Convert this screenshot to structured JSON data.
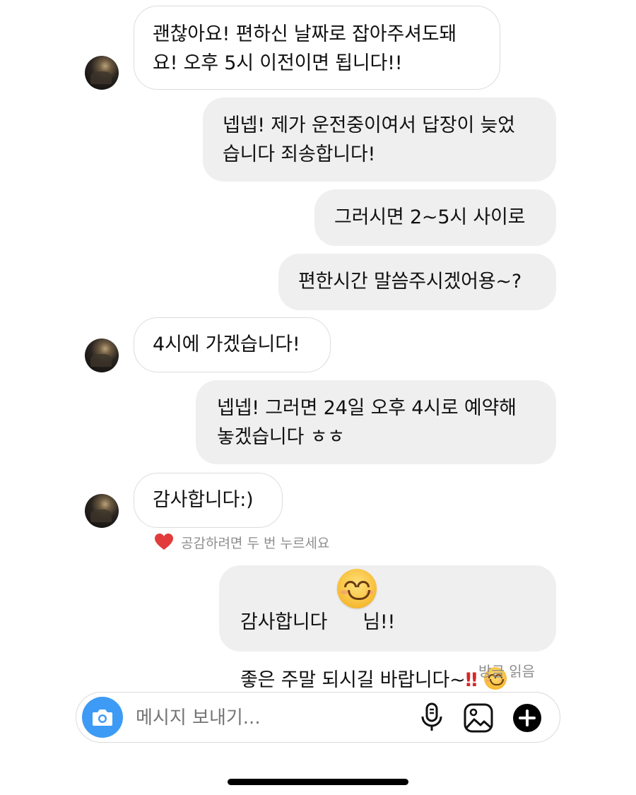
{
  "messages": [
    {
      "side": "in",
      "text": "괜찮아요! 편하신 날짜로 잡아주셔도돼\n요! 오후 5시 이전이면 됩니다!!"
    },
    {
      "side": "out",
      "text": "넵넵! 제가 운전중이여서 답장이 늦었\n습니다 죄송합니다!"
    },
    {
      "side": "out",
      "text": "그러시면 2~5시 사이로"
    },
    {
      "side": "out",
      "text": "편한시간 말씀주시겠어용~?"
    },
    {
      "side": "in",
      "text": "4시에 가겠습니다!"
    },
    {
      "side": "out",
      "text": "넵넵! 그러면 24일 오후 4시로 예약해\n놓겠습니다 ㅎㅎ"
    },
    {
      "side": "in",
      "text": "감사합니다:)"
    },
    {
      "side": "out",
      "line1_pre": "감사합니다",
      "line1_post": "님!!",
      "line2": "좋은 주말 되시길 바랍니다~",
      "bang": "‼"
    }
  ],
  "react_hint": "공감하려면 두 번 누르세요",
  "read_status": "방금 읽음",
  "composer": {
    "placeholder": "메시지 보내기..."
  },
  "icons": {
    "camera": "camera-icon",
    "mic": "microphone-icon",
    "gallery": "image-icon",
    "plus": "plus-icon",
    "heart": "heart-icon"
  },
  "colors": {
    "camera_bg": "#3d9bf5",
    "heart": "#e23b3b",
    "incoming_bubble_border": "#dcdcdc",
    "outgoing_bubble_bg": "#efefef"
  }
}
